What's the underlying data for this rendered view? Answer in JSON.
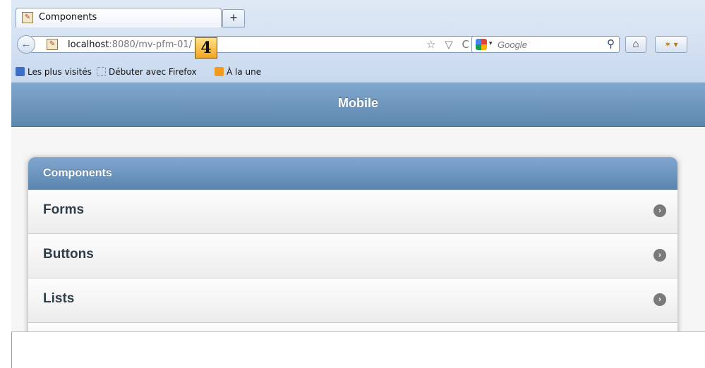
{
  "browser": {
    "tab_title": "Components",
    "new_tab": "+",
    "back": "←",
    "url_host": "localhost",
    "url_path": ":8080/mv-pfm-01/",
    "url_icons": "☆ ▽ C",
    "search_placeholder": "Google",
    "search_go": "⚲",
    "home": "⌂",
    "addon": "✶ ▾",
    "bookmarks": [
      "Les plus visités",
      "Débuter avec Firefox",
      "À la une"
    ]
  },
  "annotation": {
    "step": "4"
  },
  "mobile": {
    "header_title": "Mobile",
    "section_title": "Components",
    "items": [
      {
        "label": "Forms"
      },
      {
        "label": "Buttons"
      },
      {
        "label": "Lists"
      }
    ],
    "arrow": "›"
  },
  "colors": {
    "header_blue": "#6f98c0",
    "badge_orange": "#f3a51e"
  }
}
